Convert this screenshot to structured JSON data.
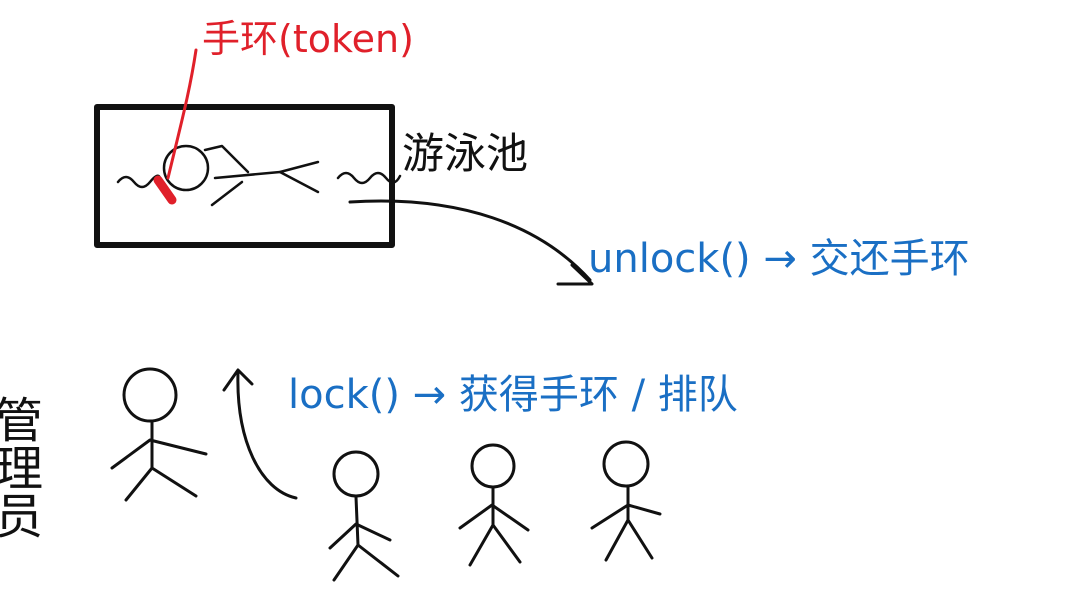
{
  "colors": {
    "ink": "#111111",
    "annotation_red": "#e0202a",
    "annotation_blue": "#1a6fc4",
    "background": "#ffffff"
  },
  "labels": {
    "wristband_token": "手环(token)",
    "pool": "游泳池",
    "unlock_note": "unlock() → 交还手环",
    "lock_note": "lock() → 获得手环 / 排队",
    "manager": "管理员"
  },
  "figures": {
    "manager": "manager-figure",
    "queue_count_label": ""
  }
}
